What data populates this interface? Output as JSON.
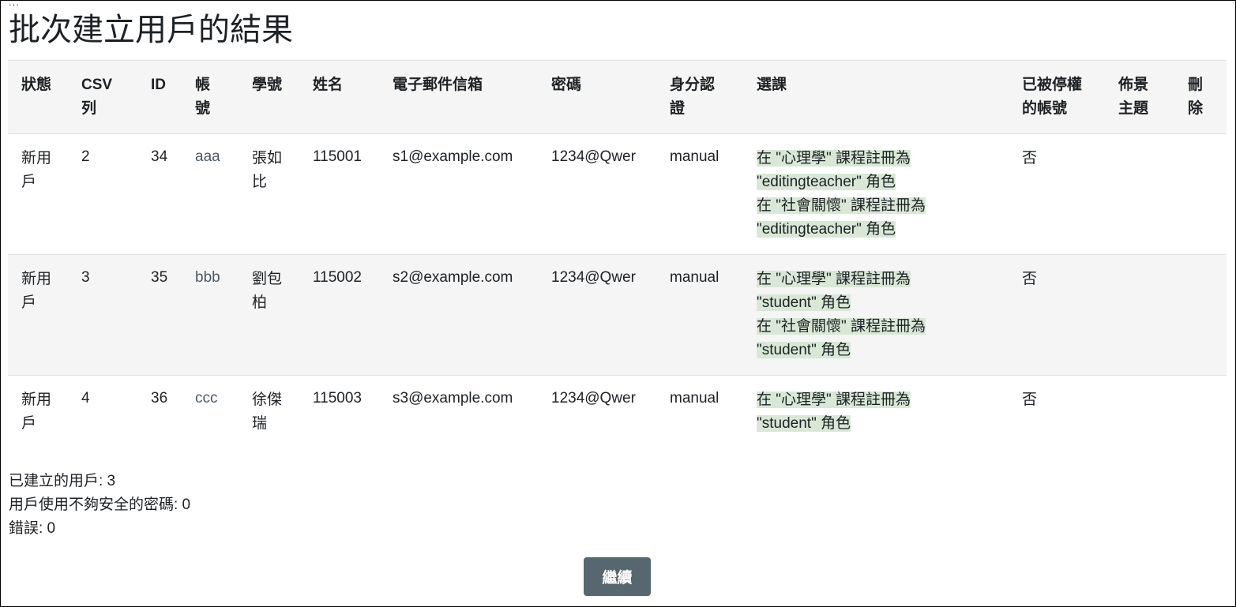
{
  "page": {
    "ellipsis": "...",
    "title": "批次建立用戶的結果"
  },
  "table": {
    "headers": {
      "status": "狀態",
      "csv_row": "CSV列",
      "id": "ID",
      "username": "帳號",
      "idnumber": "學號",
      "name": "姓名",
      "email": "電子郵件信箱",
      "password": "密碼",
      "auth": "身分認證",
      "enrolments": "選課",
      "suspended": "已被停權的帳號",
      "theme": "佈景主題",
      "delete": "刪除"
    },
    "rows": [
      {
        "status": "新用戶",
        "csv_row": "2",
        "id": "34",
        "username": "aaa",
        "idnumber": "張如比",
        "name": "115001",
        "email": "s1@example.com",
        "password": "1234@Qwer",
        "auth": "manual",
        "enrolments": [
          "在 \"心理學\" 課程註冊為 \"editingteacher\" 角色",
          "在 \"社會關懷\" 課程註冊為 \"editingteacher\" 角色"
        ],
        "suspended": "否",
        "theme": "",
        "delete": ""
      },
      {
        "status": "新用戶",
        "csv_row": "3",
        "id": "35",
        "username": "bbb",
        "idnumber": "劉包柏",
        "name": "115002",
        "email": "s2@example.com",
        "password": "1234@Qwer",
        "auth": "manual",
        "enrolments": [
          "在 \"心理學\" 課程註冊為 \"student\" 角色",
          "在 \"社會關懷\" 課程註冊為 \"student\" 角色"
        ],
        "suspended": "否",
        "theme": "",
        "delete": ""
      },
      {
        "status": "新用戶",
        "csv_row": "4",
        "id": "36",
        "username": "ccc",
        "idnumber": "徐傑瑞",
        "name": "115003",
        "email": "s3@example.com",
        "password": "1234@Qwer",
        "auth": "manual",
        "enrolments": [
          "在 \"心理學\" 課程註冊為 \"student\" 角色"
        ],
        "suspended": "否",
        "theme": "",
        "delete": ""
      }
    ]
  },
  "summary": {
    "created": "已建立的用戶: 3",
    "weak_passwords": "用戶使用不夠安全的密碼: 0",
    "errors": "錯誤: 0"
  },
  "continue_label": "繼續",
  "colors": {
    "button_bg": "#566770",
    "enrol_highlight": "#d9e8d6",
    "header_bg": "#f5f5f5",
    "link": "#4c5a67"
  }
}
